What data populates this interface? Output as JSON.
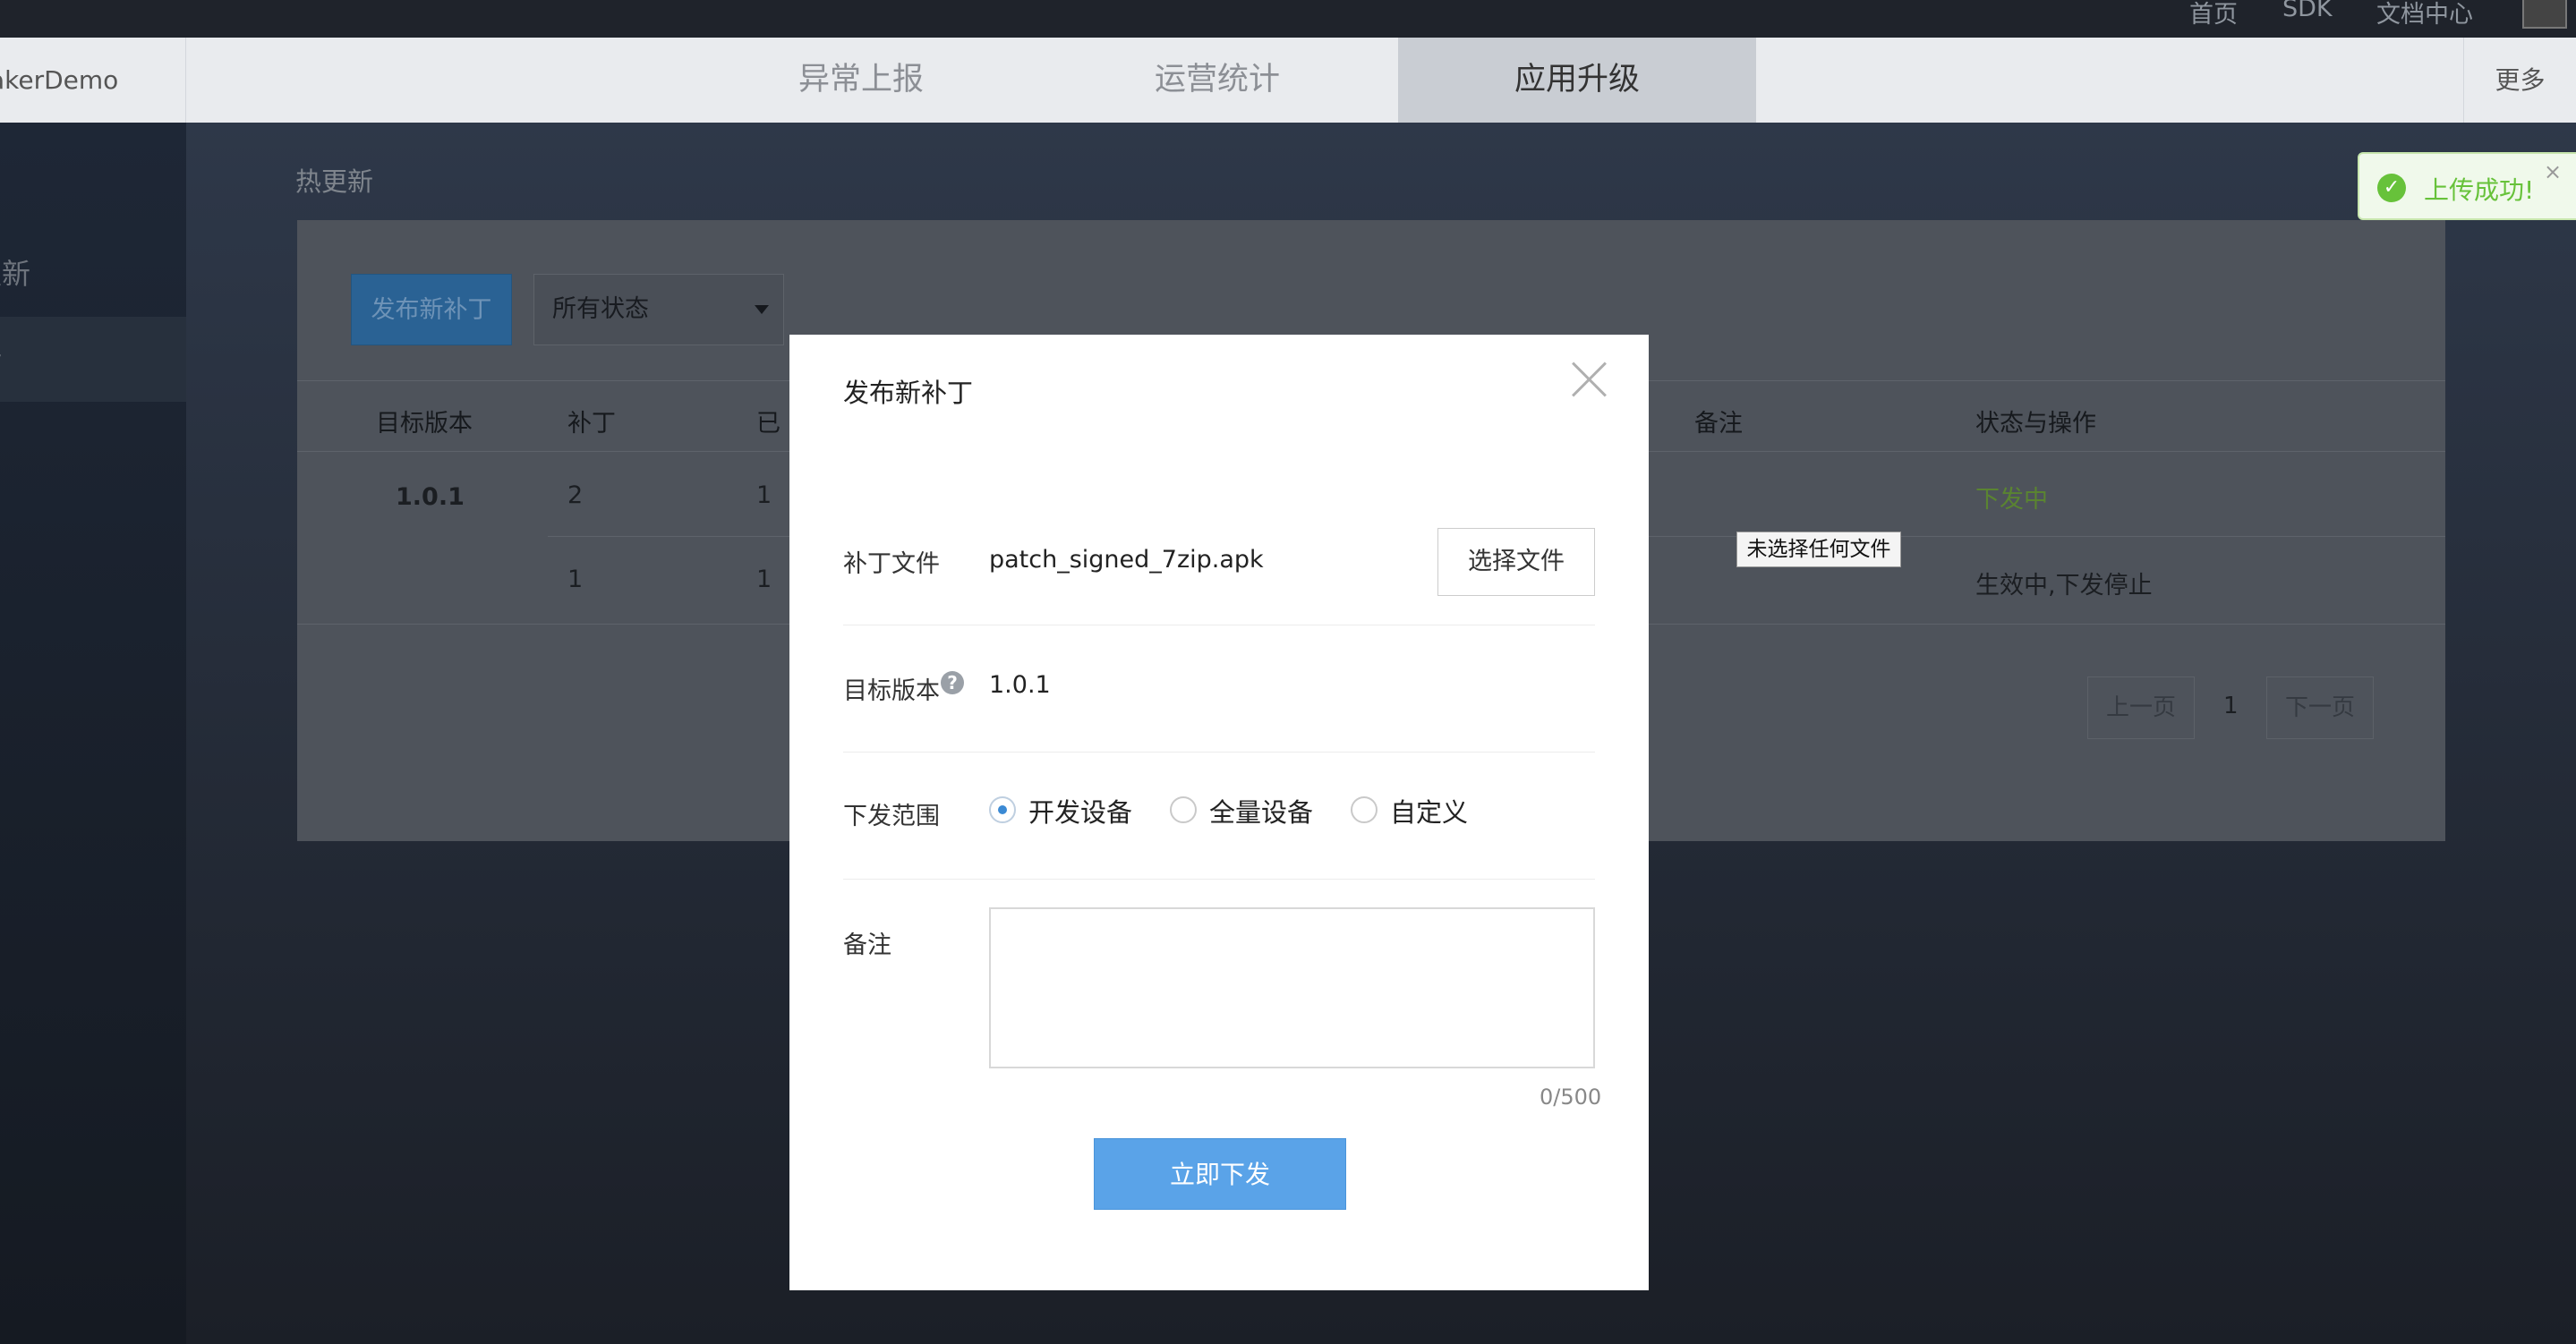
{
  "topbar": {
    "links": [
      "首页",
      "SDK",
      "文档中心"
    ]
  },
  "navbar": {
    "app_name": "akerDemo",
    "tabs": [
      "异常上报",
      "运营统计",
      "应用升级"
    ],
    "more": "更多"
  },
  "sidebar": {
    "items": [
      "更新",
      "新"
    ]
  },
  "section_title": "热更新",
  "toolbar": {
    "publish_label": "发布新补丁",
    "status_filter": "所有状态"
  },
  "table": {
    "headers": [
      "目标版本",
      "补丁",
      "已",
      "备注",
      "状态与操作"
    ],
    "rows": [
      {
        "version": "1.0.1",
        "patch": "2",
        "col3": "1",
        "status": "下发中"
      },
      {
        "version": "",
        "patch": "1",
        "col3": "1",
        "status": "生效中,下发停止"
      }
    ]
  },
  "pagination": {
    "prev": "上一页",
    "page": "1",
    "next": "下一页"
  },
  "tooltip": "未选择任何文件",
  "toast": {
    "text": "上传成功!",
    "close": "×",
    "icon": "check-circle-icon",
    "color": "#67c23a"
  },
  "modal": {
    "title": "发布新补丁",
    "file_label": "补丁文件",
    "file_name": "patch_signed_7zip.apk",
    "file_button": "选择文件",
    "version_label": "目标版本",
    "help": "?",
    "version_value": "1.0.1",
    "scope_label": "下发范围",
    "scope_options": [
      "开发设备",
      "全量设备",
      "自定义"
    ],
    "scope_selected": "开发设备",
    "note_label": "备注",
    "note_value": "",
    "counter": "0/500",
    "submit_label": "立即下发",
    "accent": "#5aa3e8"
  }
}
